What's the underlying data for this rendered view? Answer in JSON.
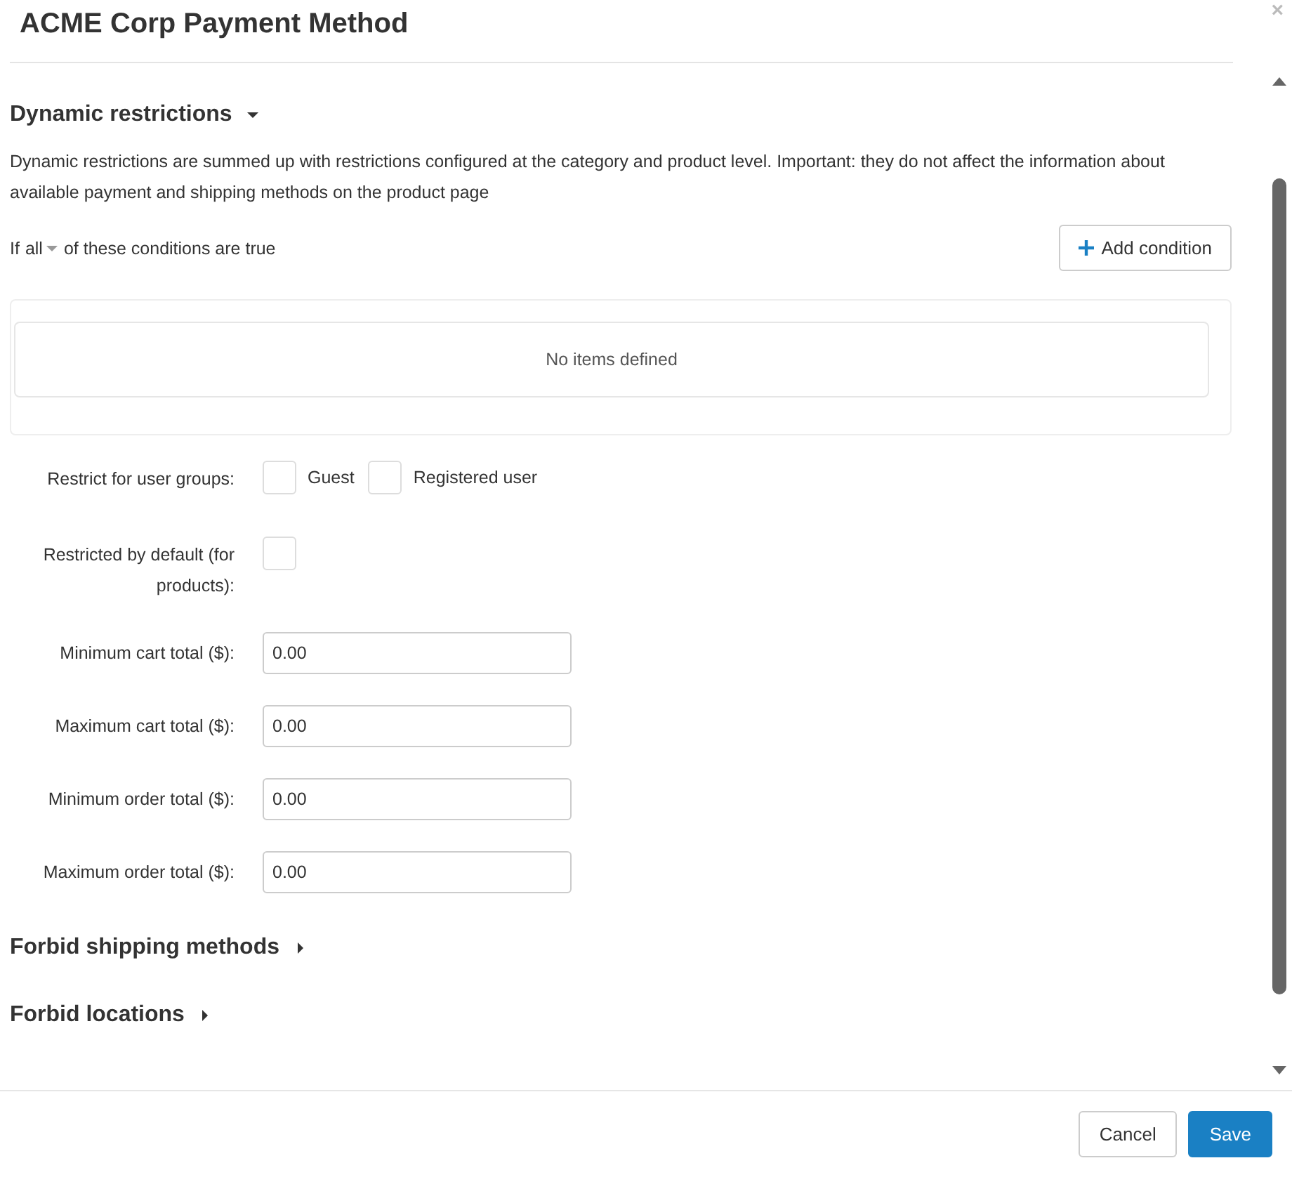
{
  "dialog": {
    "title": "ACME Corp Payment Method",
    "close": "×"
  },
  "dynamic_restrictions": {
    "title": "Dynamic restrictions",
    "expanded": true,
    "description": "Dynamic restrictions are summed up with restrictions configured at the category and product level. Important: they do not affect the information about available payment and shipping methods on the product page",
    "condition_prefix": "If",
    "condition_mode": "all",
    "condition_suffix": "of these conditions are true",
    "add_button": "Add condition",
    "empty_text": "No items defined"
  },
  "user_groups": {
    "label": "Restrict for user groups:",
    "options": [
      {
        "label": "Guest",
        "checked": false
      },
      {
        "label": "Registered user",
        "checked": false
      }
    ]
  },
  "restricted_default": {
    "label": "Restricted by default (for products):",
    "checked": false
  },
  "totals": [
    {
      "label": "Minimum cart total ($):",
      "value": "0.00"
    },
    {
      "label": "Maximum cart total ($):",
      "value": "0.00"
    },
    {
      "label": "Minimum order total ($):",
      "value": "0.00"
    },
    {
      "label": "Maximum order total ($):",
      "value": "0.00"
    }
  ],
  "sections": [
    {
      "title": "Forbid shipping methods",
      "expanded": false
    },
    {
      "title": "Forbid locations",
      "expanded": false
    }
  ],
  "buttons": [
    {
      "label": "Cancel",
      "kind": "secondary"
    },
    {
      "label": "Save",
      "kind": "primary"
    }
  ]
}
